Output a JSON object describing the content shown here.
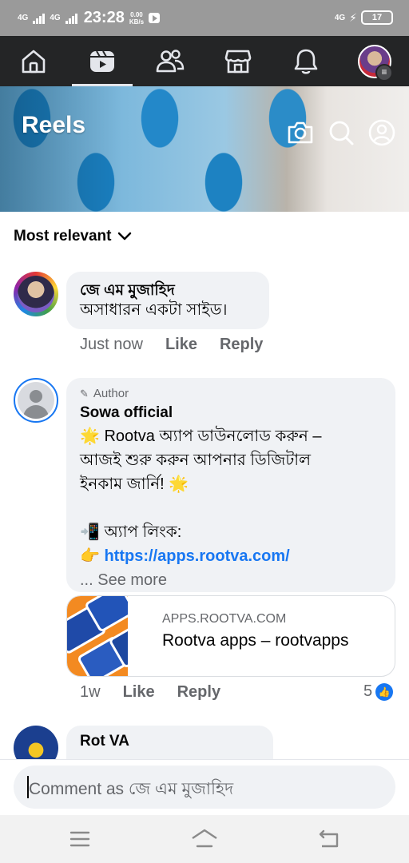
{
  "status_bar": {
    "network_left": "4G",
    "network_right": "4G",
    "time": "23:28",
    "speed_value": "0.00",
    "speed_unit": "KB/s",
    "battery": "17"
  },
  "nav": {
    "tabs": [
      {
        "name": "home",
        "icon": "home-icon",
        "active": false
      },
      {
        "name": "video",
        "icon": "video-icon",
        "active": true
      },
      {
        "name": "friends",
        "icon": "friends-icon",
        "active": false
      },
      {
        "name": "marketplace",
        "icon": "marketplace-icon",
        "active": false
      },
      {
        "name": "notifications",
        "icon": "bell-icon",
        "active": false
      },
      {
        "name": "menu",
        "icon": "profile-avatar",
        "active": false
      }
    ]
  },
  "banner": {
    "title": "Reels",
    "icons": [
      "camera-icon",
      "search-icon",
      "profile-icon"
    ]
  },
  "sort": {
    "label": "Most relevant"
  },
  "comments": [
    {
      "name": "জে এম মুজাহিদ",
      "text": "অসাধারন একটা সাইড।",
      "time": "Just now",
      "like_label": "Like",
      "reply_label": "Reply"
    },
    {
      "badge": "Author",
      "name": "Sowa official",
      "line1": "🌟 Rootva অ্যাপ ডাউনলোড করুন –",
      "line2": "আজই শুরু করুন আপনার ডিজিটাল",
      "line3": "ইনকাম জার্নি! 🌟",
      "line4": "📲 অ্যাপ লিংক:",
      "link": "https://apps.rootva.com/",
      "link_prefix": "👉",
      "see_more": "... See more",
      "preview_domain": "APPS.ROOTVA.COM",
      "preview_title": "Rootva apps – rootvapps",
      "time": "1w",
      "like_label": "Like",
      "reply_label": "Reply",
      "reaction_count": "5"
    },
    {
      "name": "Rot VA"
    }
  ],
  "composer": {
    "placeholder": "Comment as জে এম মুজাহিদ"
  },
  "colors": {
    "nav_bg": "#242526",
    "accent": "#1877f2",
    "bubble_bg": "#f0f2f5",
    "meta_text": "#65676b"
  }
}
